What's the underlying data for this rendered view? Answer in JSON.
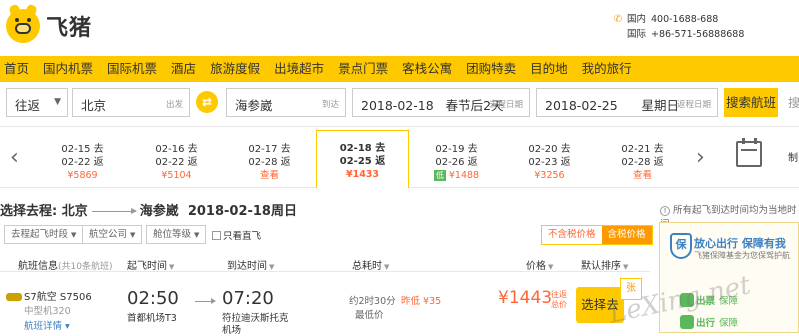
{
  "brand": {
    "name": "飞猪",
    "icon": "pig-logo-icon",
    "color": "#ffc900"
  },
  "contact": {
    "domestic_label": "国内",
    "domestic_phone": "400-1688-688",
    "intl_label": "国际",
    "intl_phone": "+86-571-56888688"
  },
  "nav": [
    "首页",
    "国内机票",
    "国际机票",
    "酒店",
    "旅游度假",
    "出境超市",
    "景点门票",
    "客栈公寓",
    "团购特卖",
    "目的地",
    "我的旅行"
  ],
  "search": {
    "trip_type": "往返",
    "from_city": "北京",
    "from_label": "出发",
    "to_city": "海参崴",
    "to_label": "到达",
    "depart_date": "2018-02-18",
    "depart_note": "春节后2天",
    "depart_label": "去程日期",
    "return_date": "2018-02-25",
    "return_weekday": "星期日",
    "return_label": "返程日期",
    "button": "搜索航班"
  },
  "date_strip": [
    {
      "go": "02-15 去",
      "back": "02-22 返",
      "price": "¥5869",
      "low": ""
    },
    {
      "go": "02-16 去",
      "back": "02-22 返",
      "price": "¥5104",
      "low": ""
    },
    {
      "go": "02-17 去",
      "back": "02-28 返",
      "price": "查看",
      "low": ""
    },
    {
      "go": "02-18 去",
      "back": "02-25 返",
      "price": "¥1433",
      "low": ""
    },
    {
      "go": "02-19 去",
      "back": "02-26 返",
      "price": "¥1488",
      "low": "低"
    },
    {
      "go": "02-20 去",
      "back": "02-23 返",
      "price": "¥3256",
      "low": ""
    },
    {
      "go": "02-21 去",
      "back": "02-28 返",
      "price": "查看",
      "low": ""
    }
  ],
  "route": {
    "prefix": "选择去程:",
    "from": "北京",
    "to": "海参崴",
    "date": "2018-02-18周日"
  },
  "timezone_note": "所有起飞到达时间均为当地时间",
  "filters": {
    "time": "去程起飞时段",
    "airline": "航空公司",
    "cabin": "舱位等级",
    "direct_only": "只看直飞"
  },
  "price_toggle": {
    "excl_tax": "不含税价格",
    "incl_tax": "含税价格"
  },
  "table_head": {
    "info": "航班信息",
    "count": "(共10条航班)",
    "depart": "起飞时间",
    "arrive": "到达时间",
    "duration": "总耗时",
    "price": "价格",
    "sort": "默认排序"
  },
  "flight": {
    "airline": "S7航空 S7506",
    "aircraft": "中型机320",
    "details": "航班详情",
    "depart_time": "02:50",
    "depart_airport": "首都机场T3",
    "arrive_time": "07:20",
    "arrive_airport_1": "符拉迪沃斯托克",
    "arrive_airport_2": "机场",
    "duration": "约2时30分",
    "duration_label": "最低价",
    "yesterday_low": "昨低 ¥35",
    "price": "¥1443",
    "price_note": "往返总价",
    "book_button": "选择去程",
    "tag": "张"
  },
  "side_ad": {
    "title": "放心出行 保障有我",
    "subtitle": "飞猪保障基金为您保驾护航",
    "row1_k": "出票",
    "row1_v": "保障",
    "row2_k": "出行",
    "row2_v": "保障"
  },
  "watermark": "LeXing.net"
}
